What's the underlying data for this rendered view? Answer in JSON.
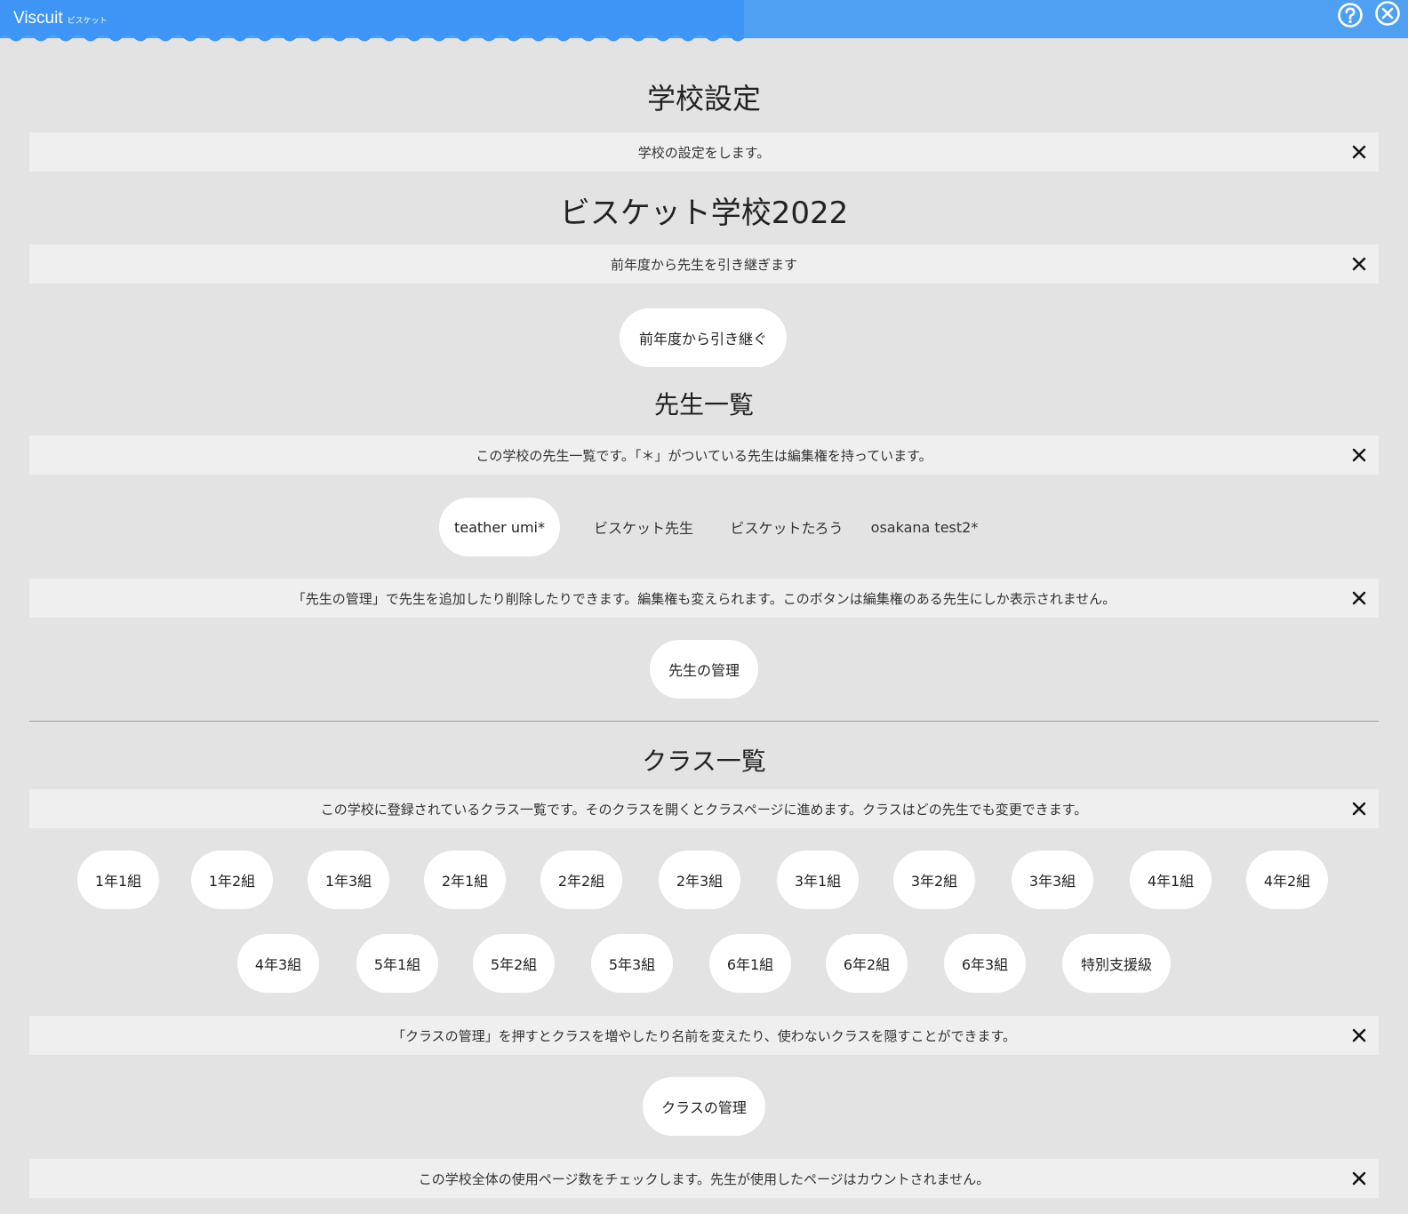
{
  "header": {
    "app_name": "Viscuit",
    "app_sub": "ビスケット",
    "help_icon": "question-circle-icon",
    "close_icon": "close-circle-icon",
    "colors": {
      "bar": "#4f9ff3",
      "wave": "#3e95f5"
    }
  },
  "school_settings": {
    "title": "学校設定",
    "notice": "学校の設定をします。"
  },
  "school": {
    "name": "ビスケット学校2022",
    "inherit_notice": "前年度から先生を引き継ぎます",
    "inherit_button": "前年度から引き継ぐ"
  },
  "teachers": {
    "title": "先生一覧",
    "notice": "この学校の先生一覧です。「＊」がついている先生は編集権を持っています。",
    "list": [
      {
        "name": "teather umi*"
      },
      {
        "name": "ビスケット先生"
      },
      {
        "name": "ビスケットたろう"
      },
      {
        "name": "osakana test2*"
      }
    ],
    "manage_notice": "「先生の管理」で先生を追加したり削除したりできます。編集権も変えられます。このボタンは編集権のある先生にしか表示されません。",
    "manage_button": "先生の管理"
  },
  "classes": {
    "title": "クラス一覧",
    "notice": "この学校に登録されているクラス一覧です。そのクラスを開くとクラスページに進めます。クラスはどの先生でも変更できます。",
    "row1": [
      "1年1組",
      "1年2組",
      "1年3組",
      "2年1組",
      "2年2組",
      "2年3組",
      "3年1組",
      "3年2組",
      "3年3組",
      "4年1組",
      "4年2組"
    ],
    "row2": [
      "4年3組",
      "5年1組",
      "5年2組",
      "5年3組",
      "6年1組",
      "6年2組",
      "6年3組",
      "特別支援級"
    ],
    "manage_notice": "「クラスの管理」を押すとクラスを増やしたり名前を変えたり、使わないクラスを隠すことができます。",
    "manage_button": "クラスの管理"
  },
  "usage": {
    "notice": "この学校全体の使用ページ数をチェックします。先生が使用したページはカウントされません。"
  }
}
